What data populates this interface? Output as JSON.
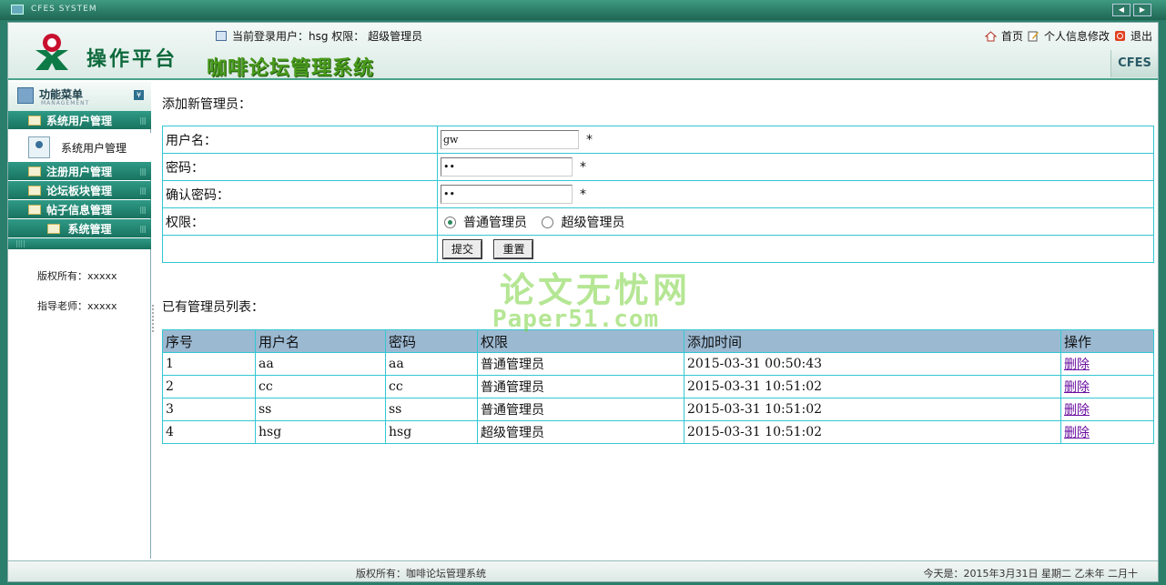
{
  "window": {
    "title": "CFES SYSTEM"
  },
  "header": {
    "brand": "操作平台",
    "system_title": "咖啡论坛管理系统",
    "userbar": "当前登录用户：hsg 权限： 超级管理员",
    "links": {
      "home": "首页",
      "profile": "个人信息修改",
      "logout": "退出"
    },
    "badge": "CFES"
  },
  "sidebar": {
    "title": "功能菜单",
    "subtitle": "MANAGEMENT",
    "items": [
      {
        "label": "系统用户管理"
      },
      {
        "label": "注册用户管理"
      },
      {
        "label": "论坛板块管理"
      },
      {
        "label": "帖子信息管理"
      },
      {
        "label": "系统管理"
      }
    ],
    "subitem": "系统用户管理",
    "copyright": "版权所有：xxxxx",
    "teacher": "指导老师：xxxxx"
  },
  "form": {
    "title": "添加新管理员：",
    "username_label": "用户名：",
    "username_value": "gw",
    "password_label": "密码：",
    "password_value": "••",
    "confirm_label": "确认密码：",
    "confirm_value": "••",
    "role_label": "权限：",
    "role_options": [
      "普通管理员",
      "超级管理员"
    ],
    "required_mark": "*",
    "submit": "提交",
    "reset": "重置"
  },
  "list": {
    "title": "已有管理员列表：",
    "headers": [
      "序号",
      "用户名",
      "密码",
      "权限",
      "添加时间",
      "操作"
    ],
    "rows": [
      [
        "1",
        "aa",
        "aa",
        "普通管理员",
        "2015-03-31 00:50:43",
        "删除"
      ],
      [
        "2",
        "cc",
        "cc",
        "普通管理员",
        "2015-03-31 10:51:02",
        "删除"
      ],
      [
        "3",
        "ss",
        "ss",
        "普通管理员",
        "2015-03-31 10:51:02",
        "删除"
      ],
      [
        "4",
        "hsg",
        "hsg",
        "超级管理员",
        "2015-03-31 10:51:02",
        "删除"
      ]
    ]
  },
  "watermark": {
    "line1": "论文无忧网",
    "line2": "Paper51.com"
  },
  "footer": {
    "copyright": "版权所有：咖啡论坛管理系统",
    "date": "今天是：2015年3月31日 星期二 乙未年 二月十"
  }
}
